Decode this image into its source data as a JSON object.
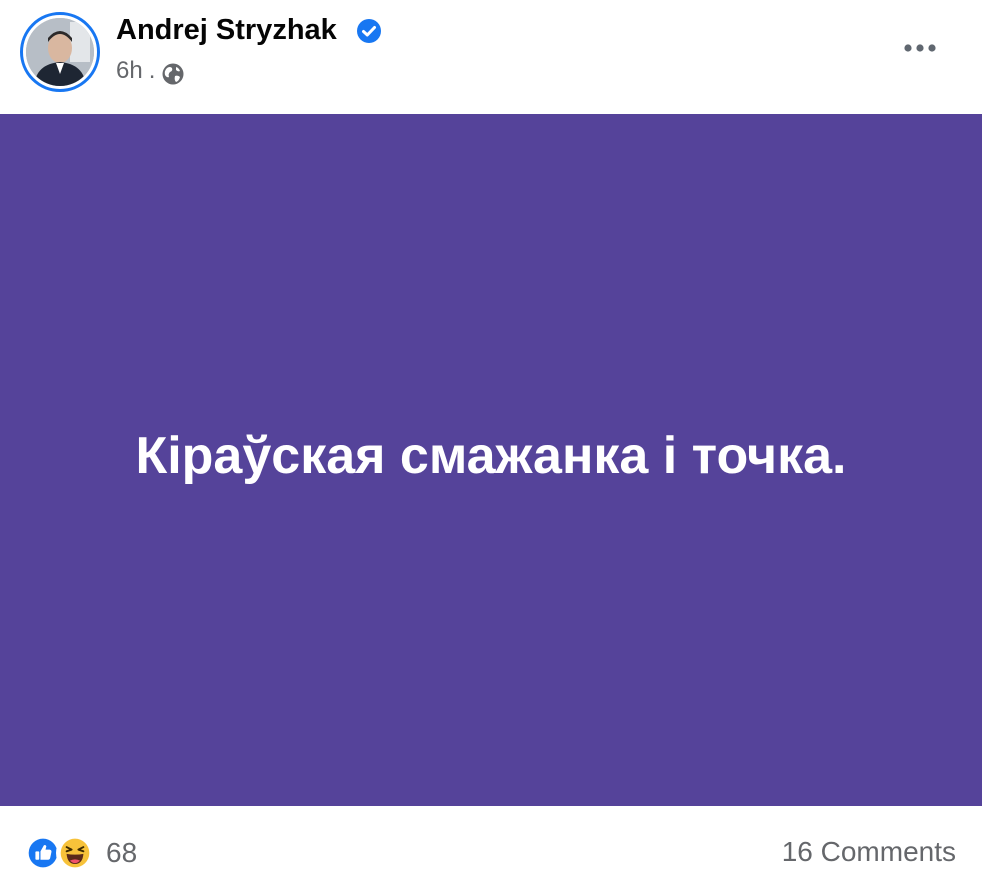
{
  "post": {
    "author": "Andrej Stryzhak",
    "time": "6h",
    "separator": ".",
    "text": "Кіраўская смажанка і точка.",
    "background_color": "#55439a"
  },
  "footer": {
    "reaction_count": "68",
    "comments": "16 Comments"
  },
  "icons": {
    "verified": "verified-badge-icon",
    "privacy": "globe-icon",
    "menu": "more-options-icon",
    "reactions": [
      "like-reaction-icon",
      "haha-reaction-icon"
    ]
  },
  "colors": {
    "accent": "#1877f2",
    "text_secondary": "#65676b"
  }
}
